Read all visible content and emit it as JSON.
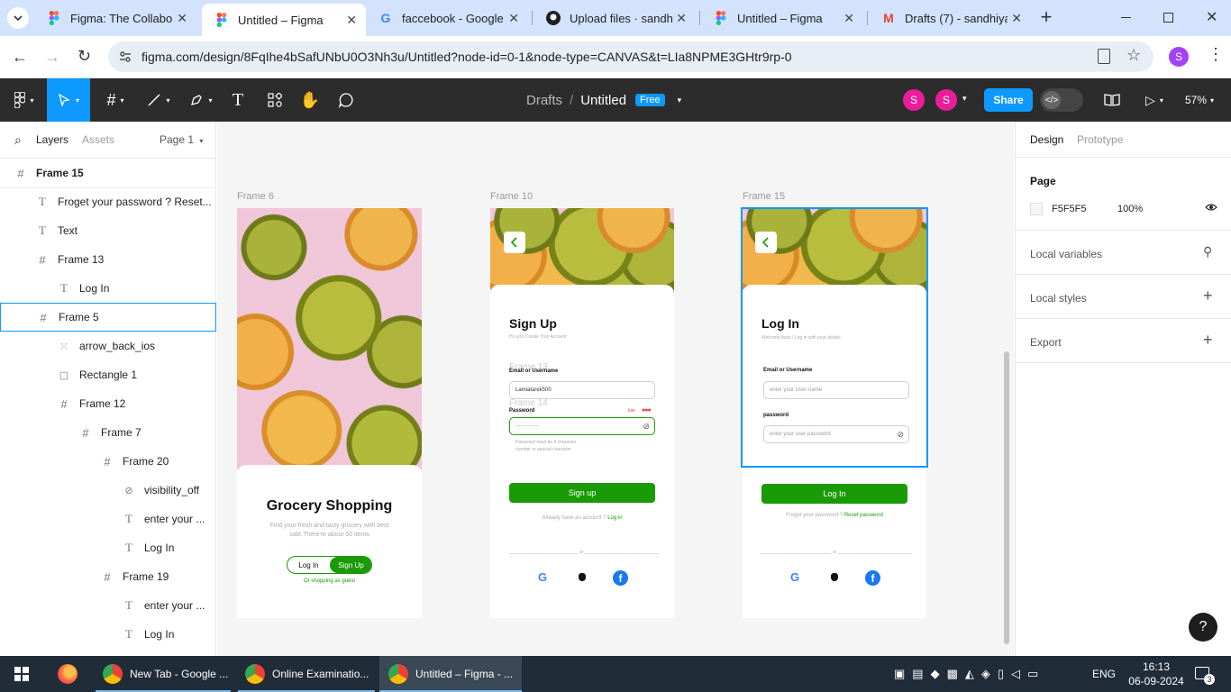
{
  "browser": {
    "tabs": [
      {
        "title": "Figma: The Collaborat",
        "icon": "figma-icon"
      },
      {
        "title": "Untitled – Figma",
        "icon": "figma-icon",
        "active": true
      },
      {
        "title": "faccebook - Google S",
        "icon": "google-icon"
      },
      {
        "title": "Upload files · sandhiy",
        "icon": "github-icon"
      },
      {
        "title": "Untitled – Figma",
        "icon": "figma-icon"
      },
      {
        "title": "Drafts (7) - sandhiyaS",
        "icon": "gmail-icon"
      }
    ],
    "url": "figma.com/design/8FqIhe4bSafUNbU0O3Nh3u/Untitled?node-id=0-1&node-type=CANVAS&t=LIa8NPME3GHtr9rp-0",
    "profile_initial": "S"
  },
  "figma": {
    "breadcrumb_parent": "Drafts",
    "breadcrumb_sep": "/",
    "file_name": "Untitled",
    "plan_badge": "Free",
    "avatars": [
      "S",
      "S"
    ],
    "share_label": "Share",
    "zoom": "57%"
  },
  "left_panel": {
    "tabs": {
      "layers": "Layers",
      "assets": "Assets",
      "page": "Page 1"
    },
    "layers": [
      {
        "name": "Frame 15",
        "type": "frame-root"
      },
      {
        "name": "Froget your password ? Reset...",
        "type": "text",
        "depth": 1
      },
      {
        "name": "Text",
        "type": "text",
        "depth": 1
      },
      {
        "name": "Frame 13",
        "type": "frame",
        "depth": 1
      },
      {
        "name": "Log In",
        "type": "text",
        "depth": 2
      },
      {
        "name": "Frame 5",
        "type": "frame",
        "depth": 1,
        "selected": true
      },
      {
        "name": "arrow_back_ios",
        "type": "component",
        "depth": 2
      },
      {
        "name": "Rectangle 1",
        "type": "rect",
        "depth": 2
      },
      {
        "name": "Frame 12",
        "type": "frame",
        "depth": 2
      },
      {
        "name": "Frame 7",
        "type": "frame",
        "depth": 3
      },
      {
        "name": "Frame 20",
        "type": "frame",
        "depth": 4
      },
      {
        "name": "visibility_off",
        "type": "icon",
        "depth": 5
      },
      {
        "name": "enter your ...",
        "type": "text",
        "depth": 5
      },
      {
        "name": "Log In",
        "type": "text",
        "depth": 5
      },
      {
        "name": "Frame 19",
        "type": "frame",
        "depth": 4
      },
      {
        "name": "enter your ...",
        "type": "text",
        "depth": 5
      },
      {
        "name": "Log In",
        "type": "text",
        "depth": 5
      }
    ]
  },
  "canvas": {
    "frame_a": {
      "label": "Frame 6",
      "title": "Grocery Shopping",
      "subtitle": "Find your fresh and tasty grocery with best sale.There're about 50 items",
      "login": "Log In",
      "signup": "Sign Up",
      "guest": "Or shopping as guest"
    },
    "frame_b": {
      "label": "Frame 10",
      "title": "Sign Up",
      "subtitle": "Hi Let's Create Your Account",
      "overlay_13": "Frame 13",
      "overlay_14": "Frame 14",
      "email_label": "Email or Username",
      "email_value": "Lamiatarek500",
      "password_label": "Password",
      "strength": "low",
      "password_value": "-------------",
      "rules": [
        "Password must be 8 character",
        "number or special character"
      ],
      "button": "Sign up",
      "have_account": "Already have an account ?",
      "login_link": "Log in",
      "or": "or"
    },
    "frame_c": {
      "label": "Frame 15",
      "title": "Log In",
      "subtitle": "Welcome back ! Log in with your details",
      "email_label": "Email or Username",
      "email_placeholder": "enter your User name",
      "password_label": "password",
      "password_placeholder": "enter your user password",
      "button": "Log In",
      "forgot": "Froget your password ?",
      "reset": "Reset password",
      "or": "or"
    },
    "colors": {
      "green": "#1a9a07",
      "selection": "#0d99ff"
    }
  },
  "right_panel": {
    "tabs": {
      "design": "Design",
      "prototype": "Prototype"
    },
    "page_title": "Page",
    "page_color": "F5F5F5",
    "page_opacity": "100%",
    "local_variables": "Local variables",
    "local_styles": "Local styles",
    "export": "Export",
    "help": "?"
  },
  "taskbar": {
    "apps": [
      {
        "label": "New Tab - Google ..."
      },
      {
        "label": "Online Examinatio..."
      },
      {
        "label": "Untitled – Figma - ..."
      }
    ],
    "lang": "ENG",
    "time": "16:13",
    "date": "06-09-2024",
    "notifications": "3"
  }
}
